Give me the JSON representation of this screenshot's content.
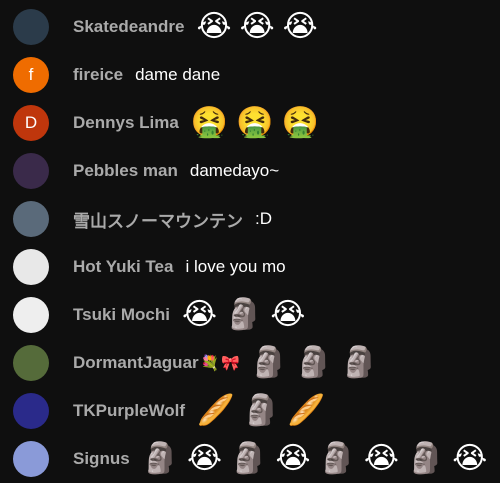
{
  "messages": [
    {
      "author": "Skatedeandre",
      "avatar_letter": "",
      "avatar_bg": "#2b3b4a",
      "badges": [],
      "text": "",
      "emojis": [
        {
          "glyph": "😭",
          "name": "loudly-crying-face-icon"
        },
        {
          "glyph": "😭",
          "name": "loudly-crying-face-icon"
        },
        {
          "glyph": "😭",
          "name": "loudly-crying-face-icon"
        }
      ]
    },
    {
      "author": "fireice",
      "avatar_letter": "f",
      "avatar_bg": "#ef6c00",
      "badges": [],
      "text": "dame dane",
      "emojis": []
    },
    {
      "author": "Dennys Lima",
      "avatar_letter": "D",
      "avatar_bg": "#bf360c",
      "badges": [],
      "text": "",
      "emojis": [
        {
          "glyph": "🤮",
          "name": "laughing-purple-face-icon"
        },
        {
          "glyph": "🤮",
          "name": "laughing-purple-face-icon"
        },
        {
          "glyph": "🤮",
          "name": "laughing-purple-face-icon"
        }
      ]
    },
    {
      "author": "Pebbles man",
      "avatar_letter": "",
      "avatar_bg": "#3a2a4a",
      "badges": [],
      "text": "damedayo~",
      "emojis": []
    },
    {
      "author": "雪山スノーマウンテン",
      "avatar_letter": "",
      "avatar_bg": "#5a6a7a",
      "badges": [],
      "text": ":D",
      "emojis": []
    },
    {
      "author": "Hot Yuki Tea",
      "avatar_letter": "",
      "avatar_bg": "#e8e8e8",
      "badges": [],
      "text": "i love you mo",
      "emojis": []
    },
    {
      "author": "Tsuki Mochi",
      "avatar_letter": "",
      "avatar_bg": "#eeeeee",
      "badges": [],
      "text": "",
      "emojis": [
        {
          "glyph": "😭",
          "name": "loudly-crying-face-icon"
        },
        {
          "glyph": "🗿",
          "name": "moai-icon"
        },
        {
          "glyph": "😭",
          "name": "loudly-crying-face-icon"
        }
      ]
    },
    {
      "author": "DormantJaguar",
      "avatar_letter": "",
      "avatar_bg": "#556b3a",
      "badges": [
        {
          "glyph": "💐",
          "name": "flower-badge-icon"
        },
        {
          "glyph": "🎀",
          "name": "ribbon-badge-icon"
        }
      ],
      "text": "",
      "emojis": [
        {
          "glyph": "🗿",
          "name": "moai-icon"
        },
        {
          "glyph": "🗿",
          "name": "moai-icon"
        },
        {
          "glyph": "🗿",
          "name": "moai-icon"
        }
      ]
    },
    {
      "author": "TKPurpleWolf",
      "avatar_letter": "",
      "avatar_bg": "#2a2a8a",
      "badges": [],
      "text": "",
      "emojis": [
        {
          "glyph": "🥖",
          "name": "baguette-icon"
        },
        {
          "glyph": "🗿",
          "name": "moai-icon"
        },
        {
          "glyph": "🥖",
          "name": "baguette-icon"
        }
      ]
    },
    {
      "author": "Signus",
      "avatar_letter": "",
      "avatar_bg": "#8a9ad8",
      "badges": [],
      "text": "",
      "emojis": [
        {
          "glyph": "🗿",
          "name": "moai-icon"
        },
        {
          "glyph": "😭",
          "name": "loudly-crying-face-icon"
        },
        {
          "glyph": "🗿",
          "name": "moai-icon"
        },
        {
          "glyph": "😭",
          "name": "loudly-crying-face-icon"
        },
        {
          "glyph": "🗿",
          "name": "moai-icon"
        },
        {
          "glyph": "😭",
          "name": "loudly-crying-face-icon"
        },
        {
          "glyph": "🗿",
          "name": "moai-icon"
        },
        {
          "glyph": "😭",
          "name": "loudly-crying-face-icon"
        }
      ]
    }
  ]
}
